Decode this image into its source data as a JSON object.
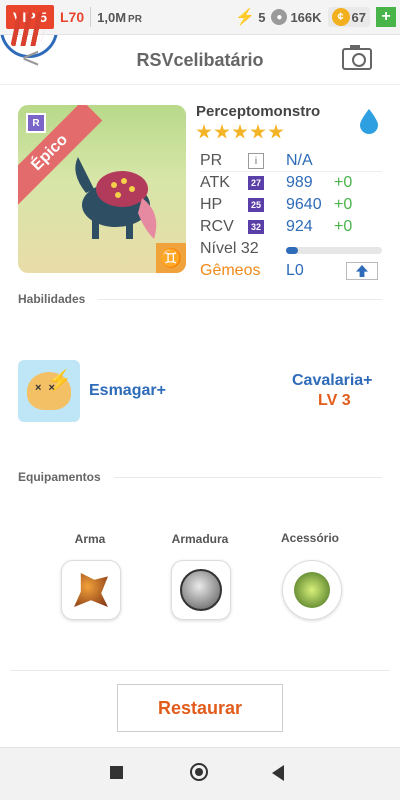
{
  "status_bar": {
    "vip": "VIP 5",
    "level": "L70",
    "pr_value": "1,0M",
    "pr_unit": "PR",
    "energy": "5",
    "paw_value": "166K",
    "coins": "67",
    "plus": "+"
  },
  "header": {
    "title": "RSVcelibatário",
    "back": "<"
  },
  "monster": {
    "name": "Perceptomonstro",
    "rarity_badge": "R",
    "rarity": "Épico",
    "stars": 5,
    "zodiac_symbol": "♊",
    "accent_colors": {
      "rarity": "#e46b6b",
      "zodiac": "#f0a23b",
      "element": "#2e9fe0"
    }
  },
  "stats": {
    "pr": {
      "label": "PR",
      "info": "i",
      "value": "N/A"
    },
    "atk": {
      "label": "ATK",
      "badge": "27",
      "value": "989",
      "bonus": "+0"
    },
    "hp": {
      "label": "HP",
      "badge": "25",
      "value": "9640",
      "bonus": "+0"
    },
    "rcv": {
      "label": "RCV",
      "badge": "32",
      "value": "924",
      "bonus": "+0"
    },
    "level": {
      "label": "Nível 32",
      "progress": 0.12
    },
    "gemini": {
      "label": "Gêmeos",
      "value": "L0"
    }
  },
  "abilities": {
    "heading": "Habilidades",
    "skill1": {
      "name": "Esmagar+"
    },
    "skill2": {
      "name": "Cavalaria+",
      "level": "LV 3"
    }
  },
  "equipment": {
    "heading": "Equipamentos",
    "weapon": "Arma",
    "armor": "Armadura",
    "accessory": "Acessório"
  },
  "actions": {
    "restore": "Restaurar"
  }
}
